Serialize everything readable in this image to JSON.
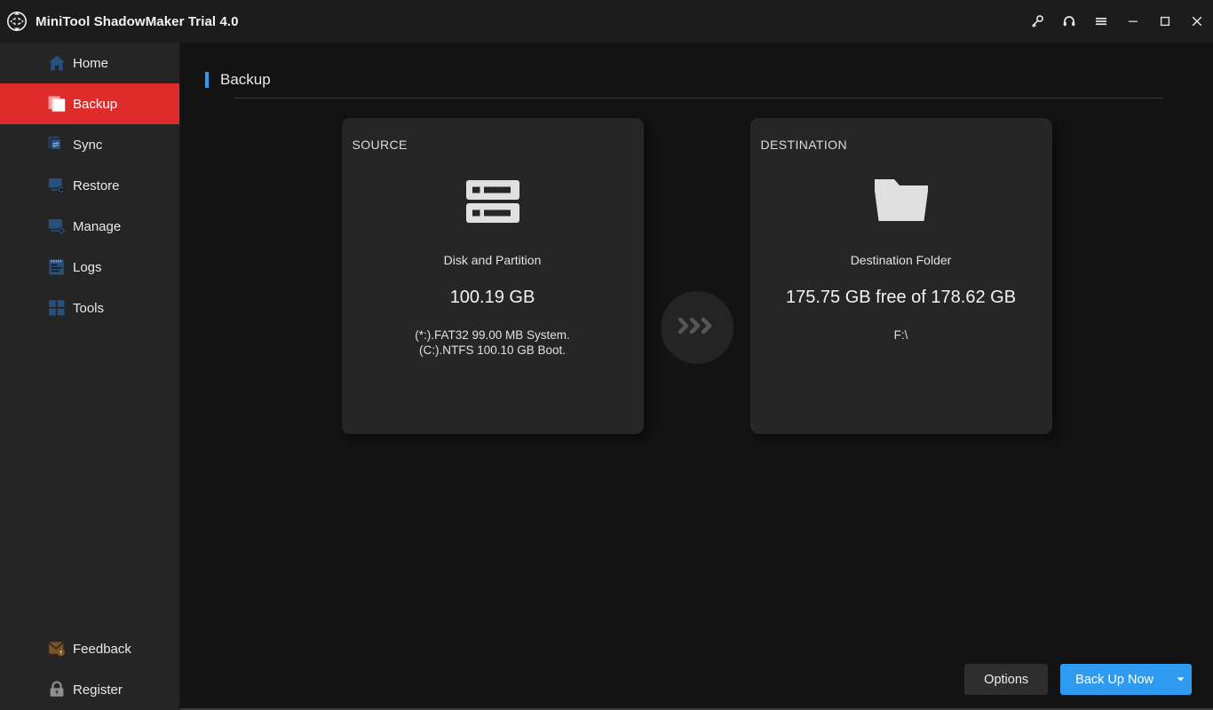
{
  "window": {
    "title": "MiniTool ShadowMaker Trial 4.0",
    "logo_icon": "sync-arrows-logo",
    "controls": [
      {
        "name": "key-icon",
        "label": "Key"
      },
      {
        "name": "headset-icon",
        "label": "Support"
      },
      {
        "name": "menu-icon",
        "label": "Menu"
      },
      {
        "name": "minimize-icon",
        "label": "Minimize"
      },
      {
        "name": "maximize-icon",
        "label": "Maximize"
      },
      {
        "name": "close-icon",
        "label": "Close"
      }
    ]
  },
  "colors": {
    "accent_blue": "#2e9bf0",
    "active_red": "#e02b2b",
    "sidebar_bg": "#252525",
    "main_bg": "#131313",
    "panel_bg": "#262626",
    "icon_blue": "#27507c",
    "feedback_brown": "#7a5326",
    "register_gray": "#8f8f8f"
  },
  "sidebar": {
    "items": [
      {
        "label": "Home",
        "icon": "home-icon",
        "active": false
      },
      {
        "label": "Backup",
        "icon": "backup-icon",
        "active": true
      },
      {
        "label": "Sync",
        "icon": "sync-icon",
        "active": false
      },
      {
        "label": "Restore",
        "icon": "restore-icon",
        "active": false
      },
      {
        "label": "Manage",
        "icon": "manage-icon",
        "active": false
      },
      {
        "label": "Logs",
        "icon": "logs-icon",
        "active": false
      },
      {
        "label": "Tools",
        "icon": "tools-icon",
        "active": false
      }
    ],
    "bottom_items": [
      {
        "label": "Feedback",
        "icon": "feedback-envelope-icon"
      },
      {
        "label": "Register",
        "icon": "register-lock-icon"
      }
    ]
  },
  "page": {
    "title": "Backup"
  },
  "source": {
    "label": "SOURCE",
    "icon": "disk-partition-icon",
    "caption": "Disk and Partition",
    "size": "100.19 GB",
    "detail_line1": "(*:).FAT32 99.00 MB System.",
    "detail_line2": "(C:).NTFS 100.10 GB Boot."
  },
  "transfer": {
    "icon": "triple-chevron-right-icon"
  },
  "destination": {
    "label": "DESTINATION",
    "icon": "folder-icon",
    "caption": "Destination Folder",
    "size": "175.75 GB free of 178.62 GB",
    "path": "F:\\"
  },
  "footer": {
    "options_label": "Options",
    "backup_label": "Back Up Now",
    "caret_icon": "caret-down-icon"
  }
}
